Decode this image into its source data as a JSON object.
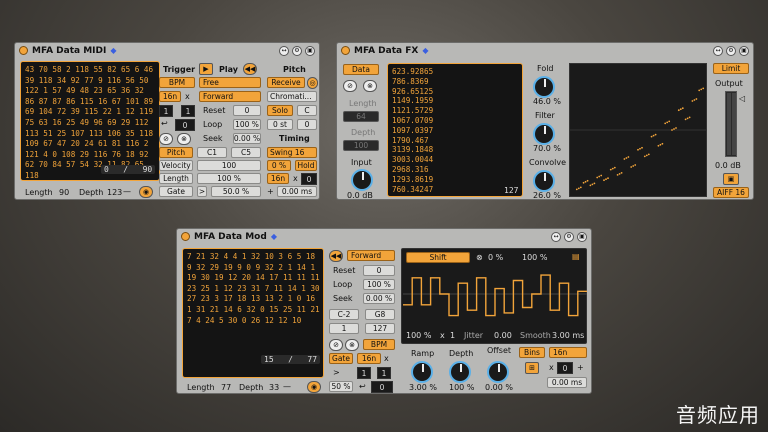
{
  "midi": {
    "title": "MFA Data MIDI",
    "sequence": "43 70 58 2 118 55 82 65 6 46 39 118 34 92 77 9 116 56 50 122 1 57 49 48 23 65 36 32 86 87 87 86 115 16 67 101 89 69 104 72 39 115 22 1 12 119 75 63 16 25 49 96 69 29 112 113 51 25 107 113 106 35 118 109 67 47 20 24 61 81 116 2 121 4 0 108 29 116 76 18 92 62 70 84 57 54 32 11 82 65 118",
    "position": "0",
    "slash": "/",
    "total": "90",
    "length_label": "Length",
    "length": "90",
    "depth_label": "Depth",
    "depth": "123",
    "trigger_label": "Trigger",
    "bpm": "BPM",
    "rate": "16n",
    "x": "x",
    "ratio_a": "1",
    "ratio_b": "1",
    "offset": "0",
    "pitch_btn": "Pitch",
    "velocity_btn": "Velocity",
    "length_btn": "Length",
    "gate_btn": "Gate",
    "range_lo": "C1",
    "range_hi": "C5",
    "vel_val": "100",
    "len_val": "100 %",
    "gate_val": "50.0 %",
    "gate_arrow": ">",
    "play_label": "Play",
    "mode": "Free",
    "direction": "Forward",
    "reset_label": "Reset",
    "reset_val": "0",
    "loop_label": "Loop",
    "loop_val": "100 %",
    "seek_label": "Seek",
    "seek_val": "0.00 %",
    "pitch_label": "Pitch",
    "receive": "Receive",
    "scale": "Chromati...",
    "solo": "Solo",
    "key": "C",
    "st": "0 st",
    "st_val": "0",
    "timing_label": "Timing",
    "swing": "Swing 16",
    "swing_val": "0 %",
    "hold": "Hold",
    "trate": "16n",
    "tx": "x",
    "tval": "0",
    "tplus": "+",
    "tms": "0.00 ms"
  },
  "fx": {
    "title": "MFA Data FX",
    "data_btn": "Data",
    "values": [
      "623.92865",
      "786.8369",
      "926.65125",
      "1149.1959",
      "1121.5729",
      "1067.0709",
      "1097.0397",
      "1790.467",
      "3139.1848",
      "3003.0044",
      "2968.316",
      "1293.8619",
      "760.34247"
    ],
    "count": "127",
    "length_label": "Length",
    "length": "64",
    "depth_label": "Depth",
    "depth": "100",
    "input_label": "Input",
    "input_val": "0.0 dB",
    "fold_label": "Fold",
    "fold_val": "46.0 %",
    "filter_label": "Filter",
    "filter_val": "70.0 %",
    "convolve_label": "Convolve",
    "convolve_val": "26.0 %",
    "limit": "Limit",
    "output_label": "Output",
    "output_val": "0.0 dB",
    "format": "AIFF 16"
  },
  "mod": {
    "title": "MFA Data Mod",
    "sequence": "7 21 32 4 4 1 32 10 3 6 5 18 9 32 29 19 9 0 9 32 2 1 14 1 19 30 19 12 20 14 17 11 11 11 23 25 1 12 23 31 7 11 14 1 30 27 23 3 17 18 13 13 2 1 0 16 1 31 21 14 6 32 0 15 25 11 21 7 4 24 5 30 0 26 12 12 10",
    "position": "15",
    "slash": "/",
    "total": "77",
    "length_label": "Length",
    "length": "77",
    "depth_label": "Depth",
    "depth": "33",
    "direction": "Forward",
    "reset_label": "Reset",
    "reset_val": "0",
    "loop_label": "Loop",
    "loop_val": "100 %",
    "seek_label": "Seek",
    "seek_val": "0.00 %",
    "range_lo": "C-2",
    "range_hi": "G8",
    "min_val": "1",
    "max_val": "127",
    "shift": "Shift",
    "shift_val": "0 %",
    "amount": "100 %",
    "scale_pct": "100 %",
    "scale_x": "x",
    "scale_n": "1",
    "jitter_label": "Jitter",
    "jitter_val": "0.00",
    "smooth_label": "Smooth",
    "smooth_val": "3.00 ms",
    "gate": "Gate",
    "bpm": "BPM",
    "rate": "16n",
    "x": "x",
    "ratio_a": "1",
    "ratio_b": "1",
    "gate_pct": "50 %",
    "gate_off": "0",
    "ramp_label": "Ramp",
    "ramp_val": "3.00 %",
    "depth_knob_label": "Depth",
    "depth_knob_val": "100 %",
    "offset_label": "Offset",
    "offset_val": "0.00 %",
    "bins": "Bins",
    "brate": "16n",
    "bx": "x",
    "bval": "0",
    "bplus": "+",
    "bms": "0.00 ms"
  },
  "watermark": "音频应用",
  "colors": {
    "accent": "#f2a43a",
    "knob": "#5ab0e8",
    "panel": "#b8b8b6"
  },
  "fx_scope_points": [
    [
      0.05,
      0.95
    ],
    [
      0.1,
      0.9
    ],
    [
      0.15,
      0.92
    ],
    [
      0.2,
      0.86
    ],
    [
      0.25,
      0.88
    ],
    [
      0.3,
      0.8
    ],
    [
      0.35,
      0.84
    ],
    [
      0.4,
      0.72
    ],
    [
      0.45,
      0.78
    ],
    [
      0.5,
      0.65
    ],
    [
      0.55,
      0.7
    ],
    [
      0.6,
      0.55
    ],
    [
      0.65,
      0.62
    ],
    [
      0.7,
      0.45
    ],
    [
      0.75,
      0.5
    ],
    [
      0.8,
      0.35
    ],
    [
      0.85,
      0.42
    ],
    [
      0.9,
      0.28
    ],
    [
      0.95,
      0.2
    ]
  ],
  "mod_wave": [
    0.7,
    0.2,
    0.7,
    0.2,
    0.5,
    0.9,
    0.3,
    0.8,
    0.2,
    0.9,
    0.4,
    0.85,
    0.25,
    0.75,
    0.5,
    0.15,
    0.8,
    0.3,
    0.9,
    0.45
  ]
}
